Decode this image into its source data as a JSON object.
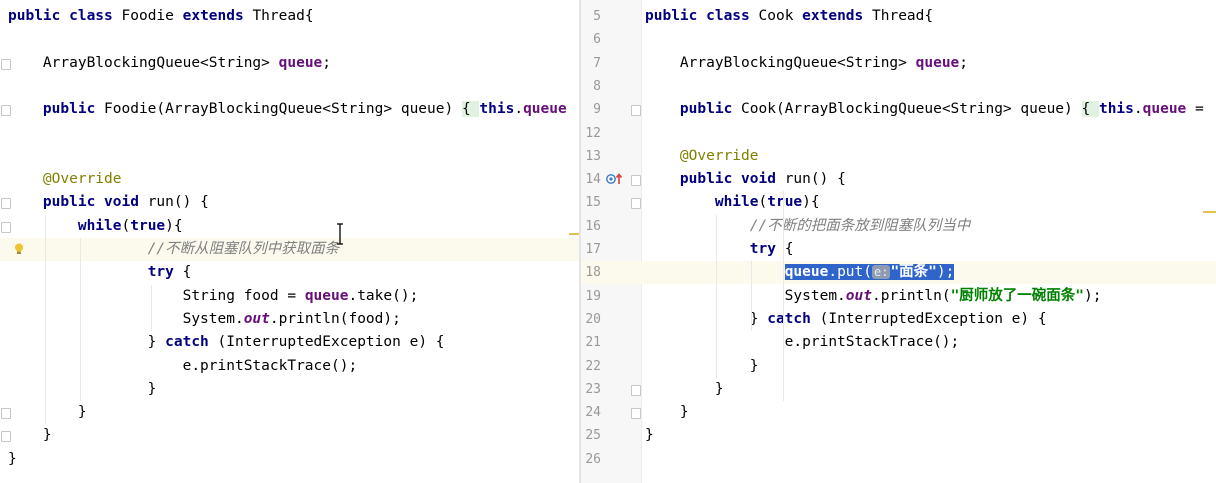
{
  "left_editor": {
    "lines": [
      {
        "parts": [
          [
            "kw",
            "public class "
          ],
          [
            "plain",
            "Foodie "
          ],
          [
            "kw",
            "extends "
          ],
          [
            "plain",
            "Thread{"
          ]
        ]
      },
      {
        "parts": []
      },
      {
        "parts": [
          [
            "plain",
            "    ArrayBlockingQueue<String> "
          ],
          [
            "field",
            "queue"
          ],
          [
            "plain",
            ";"
          ]
        ]
      },
      {
        "parts": []
      },
      {
        "parts": [
          [
            "plain",
            "    "
          ],
          [
            "kw",
            "public "
          ],
          [
            "plain",
            "Foodie(ArrayBlockingQueue<String> queue) "
          ],
          [
            "brace-hl",
            "{ "
          ],
          [
            "kw",
            "this"
          ],
          [
            "plain",
            "."
          ],
          [
            "field",
            "queue"
          ]
        ]
      },
      {
        "parts": []
      },
      {
        "parts": []
      },
      {
        "parts": [
          [
            "ann",
            "    @Override"
          ]
        ]
      },
      {
        "parts": [
          [
            "plain",
            "    "
          ],
          [
            "kw",
            "public void "
          ],
          [
            "plain",
            "run() {"
          ]
        ]
      },
      {
        "parts": [
          [
            "plain",
            "        "
          ],
          [
            "kw",
            "while"
          ],
          [
            "plain",
            "("
          ],
          [
            "kw",
            "true"
          ],
          [
            "plain",
            "){"
          ]
        ]
      },
      {
        "parts": [
          [
            "cmt",
            "                //不断从阻塞队列中获取面条"
          ]
        ]
      },
      {
        "parts": [
          [
            "plain",
            "                "
          ],
          [
            "kw",
            "try "
          ],
          [
            "plain",
            "{"
          ]
        ]
      },
      {
        "parts": [
          [
            "plain",
            "                    String food = "
          ],
          [
            "field",
            "queue"
          ],
          [
            "plain",
            ".take();"
          ]
        ]
      },
      {
        "parts": [
          [
            "plain",
            "                    System."
          ],
          [
            "static-field",
            "out"
          ],
          [
            "plain",
            ".println(food);"
          ]
        ]
      },
      {
        "parts": [
          [
            "plain",
            "                } "
          ],
          [
            "kw",
            "catch "
          ],
          [
            "plain",
            "(InterruptedException e) {"
          ]
        ]
      },
      {
        "parts": [
          [
            "plain",
            "                    e.printStackTrace();"
          ]
        ]
      },
      {
        "parts": [
          [
            "plain",
            "                }"
          ]
        ]
      },
      {
        "parts": [
          [
            "plain",
            "        }"
          ]
        ]
      },
      {
        "parts": [
          [
            "plain",
            "    }"
          ]
        ]
      },
      {
        "parts": [
          [
            "plain",
            "}"
          ]
        ]
      }
    ]
  },
  "right_editor": {
    "line_numbers": [
      "5",
      "6",
      "7",
      "8",
      "9",
      "12",
      "13",
      "14",
      "15",
      "16",
      "17",
      "18",
      "19",
      "20",
      "21",
      "22",
      "23",
      "24",
      "25",
      "26"
    ],
    "lines": [
      {
        "parts": [
          [
            "kw",
            "public class "
          ],
          [
            "plain",
            "Cook "
          ],
          [
            "kw",
            "extends "
          ],
          [
            "plain",
            "Thread{"
          ]
        ]
      },
      {
        "parts": []
      },
      {
        "parts": [
          [
            "plain",
            "    ArrayBlockingQueue<String> "
          ],
          [
            "field",
            "queue"
          ],
          [
            "plain",
            ";"
          ]
        ]
      },
      {
        "parts": []
      },
      {
        "parts": [
          [
            "plain",
            "    "
          ],
          [
            "kw",
            "public "
          ],
          [
            "plain",
            "Cook(ArrayBlockingQueue<String> queue) "
          ],
          [
            "brace-hl",
            "{ "
          ],
          [
            "kw",
            "this"
          ],
          [
            "plain",
            "."
          ],
          [
            "field",
            "queue"
          ],
          [
            "plain",
            " ="
          ]
        ]
      },
      {
        "parts": []
      },
      {
        "parts": [
          [
            "ann",
            "    @Override"
          ]
        ]
      },
      {
        "parts": [
          [
            "plain",
            "    "
          ],
          [
            "kw",
            "public void "
          ],
          [
            "plain",
            "run() {"
          ]
        ]
      },
      {
        "parts": [
          [
            "plain",
            "        "
          ],
          [
            "kw",
            "while"
          ],
          [
            "plain",
            "("
          ],
          [
            "kw",
            "true"
          ],
          [
            "plain",
            "){"
          ]
        ]
      },
      {
        "parts": [
          [
            "cmt",
            "            //不断的把面条放到阻塞队列当中"
          ]
        ]
      },
      {
        "parts": [
          [
            "plain",
            "            "
          ],
          [
            "kw",
            "try "
          ],
          [
            "plain",
            "{"
          ]
        ]
      },
      {
        "parts": [
          [
            "plain",
            "                "
          ],
          [
            "sel-start",
            ""
          ],
          [
            "field",
            "queue"
          ],
          [
            "plain",
            ".put("
          ],
          [
            "hint",
            "e:"
          ],
          [
            "str",
            "\"面条\""
          ],
          [
            "plain",
            ");"
          ],
          [
            "sel-end",
            ""
          ]
        ]
      },
      {
        "parts": [
          [
            "plain",
            "                System."
          ],
          [
            "static-field",
            "out"
          ],
          [
            "plain",
            ".println("
          ],
          [
            "str",
            "\"厨师放了一碗面条\""
          ],
          [
            "plain",
            ");"
          ]
        ]
      },
      {
        "parts": [
          [
            "plain",
            "            } "
          ],
          [
            "kw",
            "catch "
          ],
          [
            "plain",
            "(InterruptedException e) {"
          ]
        ]
      },
      {
        "parts": [
          [
            "plain",
            "                e.printStackTrace();"
          ]
        ]
      },
      {
        "parts": [
          [
            "plain",
            "            }"
          ]
        ]
      },
      {
        "parts": [
          [
            "plain",
            "        }"
          ]
        ]
      },
      {
        "parts": [
          [
            "plain",
            "    }"
          ]
        ]
      },
      {
        "parts": [
          [
            "plain",
            "}"
          ]
        ]
      },
      {
        "parts": []
      }
    ]
  },
  "icons": {
    "left_intention": "lightbulb-icon",
    "right_override": "override-method-icon",
    "folding": "fold-marker-icon"
  },
  "colors": {
    "keyword": "#000080",
    "field": "#660e7a",
    "annotation": "#808000",
    "comment": "#808080",
    "string": "#008000",
    "selection": "#2f65ca",
    "current_line": "#fcfaed"
  }
}
